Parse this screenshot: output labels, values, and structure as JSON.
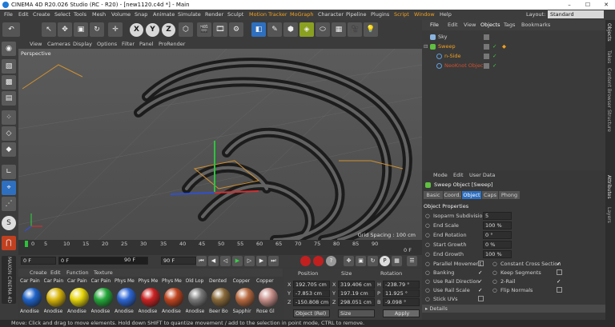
{
  "window": {
    "title": "CINEMA 4D R20.026 Studio (RC - R20) - [new1120.c4d *] - Main",
    "minimize": "–",
    "maximize": "☐",
    "close": "✕"
  },
  "menu": [
    "File",
    "Edit",
    "Create",
    "Select",
    "Tools",
    "Mesh",
    "Volume",
    "Snap",
    "Animate",
    "Simulate",
    "Render",
    "Sculpt",
    "Motion Tracker",
    "MoGraph",
    "Character",
    "Pipeline",
    "Plugins",
    "Script",
    "Window",
    "Help"
  ],
  "layout": {
    "label": "Layout:",
    "value": "Standard"
  },
  "toolbar": {
    "undo": "↶",
    "x": "X",
    "y": "Y",
    "z": "Z"
  },
  "viewport": {
    "menu": [
      "View",
      "Cameras",
      "Display",
      "Options",
      "Filter",
      "Panel",
      "ProRender"
    ],
    "label": "Perspective",
    "grid": "Grid Spacing : 100 cm"
  },
  "timeline": {
    "ticks": [
      "0",
      "5",
      "10",
      "15",
      "20",
      "25",
      "30",
      "35",
      "40",
      "45",
      "50",
      "55",
      "60",
      "65",
      "70",
      "75",
      "80",
      "85",
      "90"
    ],
    "end": "0 F"
  },
  "transport": {
    "start": "0 F",
    "cur": "0 F",
    "max": "90 F",
    "max2": "90 F"
  },
  "materials": {
    "menu": [
      "Create",
      "Edit",
      "Function",
      "Texture"
    ],
    "items": [
      {
        "top": "Car Pain",
        "bot": "Anodise",
        "color": "#1f63c9"
      },
      {
        "top": "Car Pain",
        "bot": "Anodise",
        "color": "#d8b50a"
      },
      {
        "top": "Car Pain",
        "bot": "Anodise",
        "color": "#e6d50a"
      },
      {
        "top": "Car Pain",
        "bot": "Anodise",
        "color": "#25a83a"
      },
      {
        "top": "Phys Me",
        "bot": "Anodise",
        "color": "#2d66d4"
      },
      {
        "top": "Phys Me",
        "bot": "Anodise",
        "color": "#cc2323"
      },
      {
        "top": "Phys Me",
        "bot": "Anodise",
        "color": "#c04520"
      },
      {
        "top": "Old Lop",
        "bot": "Anodise",
        "color": "#7a7a7a"
      },
      {
        "top": "Dented",
        "bot": "Beer Bo",
        "color": "#8a6a3a"
      },
      {
        "top": "Copper",
        "bot": "Sapphir",
        "color": "#b86a40"
      },
      {
        "top": "Copper",
        "bot": "Rose Gl",
        "color": "#c8908a"
      }
    ]
  },
  "coords": {
    "heads": [
      "Position",
      "Size",
      "Rotation"
    ],
    "rows": [
      {
        "a": "X",
        "pos": "192.705 cm",
        "s": "X",
        "size": "319.406 cm",
        "r": "H",
        "rot": "-238.79 °"
      },
      {
        "a": "Y",
        "pos": "-7.853 cm",
        "s": "Y",
        "size": "197.19 cm",
        "r": "P",
        "rot": "11.925 °"
      },
      {
        "a": "Z",
        "pos": "-150.808 cm",
        "s": "Z",
        "size": "298.051 cm",
        "r": "B",
        "rot": "-9.098 °"
      }
    ],
    "mode": "Object (Rel)",
    "mode2": "Size",
    "apply": "Apply"
  },
  "objects": {
    "tabs": [
      "File",
      "Edit",
      "View",
      "Objects",
      "Tags",
      "Bookmarks"
    ],
    "rows": [
      {
        "name": "Sky",
        "color": "#cfcfcf",
        "indent": 0
      },
      {
        "name": "Sweep",
        "color": "#f0a020",
        "indent": 0
      },
      {
        "name": "n-Side",
        "color": "#f0a020",
        "indent": 1
      },
      {
        "name": "NeoKnot Object",
        "color": "#d05030",
        "indent": 1
      }
    ]
  },
  "attributes": {
    "menu": [
      "Mode",
      "Edit",
      "User Data"
    ],
    "title": "Sweep Object [Sweep]",
    "tabs": [
      "Basic",
      "Coord.",
      "Object",
      "Caps",
      "Phong"
    ],
    "section": "Object Properties",
    "props": [
      {
        "l": "Isoparm Subdivision",
        "v": "5"
      },
      {
        "l": "End Scale",
        "v": "100 %"
      },
      {
        "l": "End Rotation",
        "v": "0 °"
      },
      {
        "l": "Start Growth",
        "v": "0 %"
      },
      {
        "l": "End Growth",
        "v": "100 %"
      }
    ],
    "checks": [
      {
        "l": "Parallel Movement",
        "v": ""
      },
      {
        "l": "Constant Cross Section",
        "v": "✓"
      },
      {
        "l": "Banking",
        "v": "✓"
      },
      {
        "l": "Keep Segments",
        "v": ""
      },
      {
        "l": "Use Rail Direction",
        "v": "✓"
      },
      {
        "l": "2-Rail",
        "v": "✓"
      },
      {
        "l": "Use Rail Scale",
        "v": "✓"
      },
      {
        "l": "Flip Normals",
        "v": ""
      },
      {
        "l": "Stick UVs",
        "v": ""
      }
    ],
    "details": "Details"
  },
  "sidetabs": [
    "Objects",
    "Takes",
    "Content Browser",
    "Structure",
    "Attributes",
    "Layers"
  ],
  "status": "Move: Click and drag to move elements. Hold down SHIFT to quantize movement / add to the selection in point mode, CTRL to remove."
}
